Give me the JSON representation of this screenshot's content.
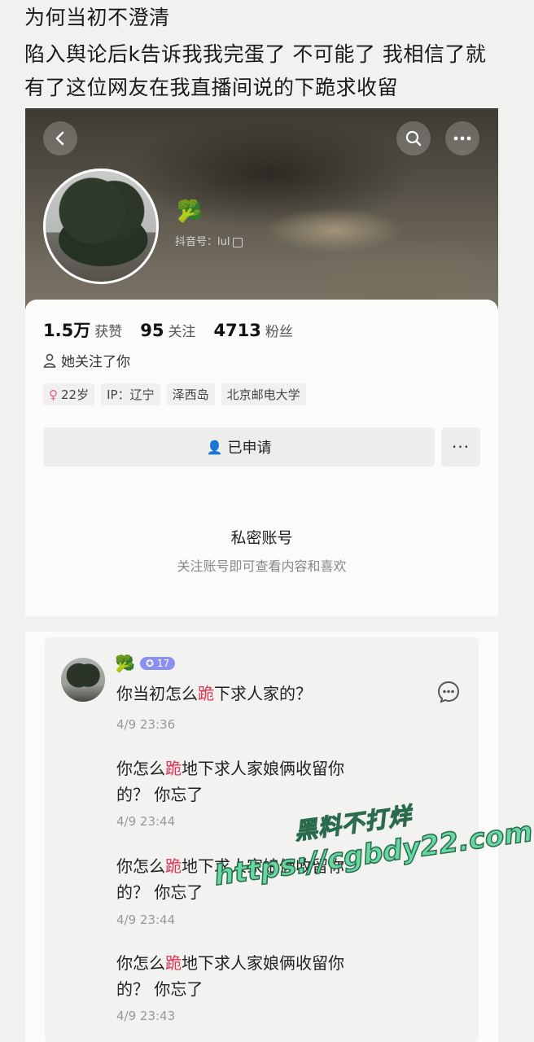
{
  "post": {
    "line1": "为何当初不澄清",
    "line2": "陷入舆论后k告诉我我完蛋了 不可能了 我相信了就",
    "line3": "有了这位网友在我直播间说的下跪求收留"
  },
  "profile": {
    "emoji": "🥦",
    "douyin_id": "抖音号：lul",
    "stats": [
      {
        "num": "1.5万",
        "label": "获赞"
      },
      {
        "num": "95",
        "label": "关注"
      },
      {
        "num": "4713",
        "label": "粉丝"
      }
    ],
    "follows_you": "她关注了你",
    "tags": [
      "22岁",
      "IP：辽宁",
      "泽西岛",
      "北京邮电大学"
    ],
    "apply_label": "已申请",
    "more_label": "···",
    "private_title": "私密账号",
    "private_sub": "关注账号即可查看内容和喜欢",
    "icons": [
      "back-icon",
      "search-icon",
      "more-icon",
      "copy-icon"
    ]
  },
  "comments": {
    "emoji": "🥦",
    "level": "17",
    "messages": [
      {
        "pre": "你当初怎么",
        "hl": "跪",
        "post": "下求人家的？",
        "line2": "",
        "time": "4/9 23:36"
      },
      {
        "pre": "你怎么",
        "hl": "跪",
        "post": "地下求人家娘俩收留你",
        "line2": "的？ 你忘了",
        "time": "4/9 23:44"
      },
      {
        "pre": "你怎么",
        "hl": "跪",
        "post": "地下求人家娘俩收留你",
        "line2": "的？ 你忘了",
        "time": "4/9 23:44"
      },
      {
        "pre": "你怎么",
        "hl": "跪",
        "post": "地下求人家娘俩收留你",
        "line2": "的？ 你忘了",
        "time": "4/9 23:43"
      }
    ]
  },
  "watermark": {
    "line1": "黑料不打烊",
    "line2": "https://cgbdy22.com"
  },
  "colors": {
    "highlight": "#e53353",
    "level_badge": "#8a90f0",
    "watermark": "#67d7a4"
  }
}
